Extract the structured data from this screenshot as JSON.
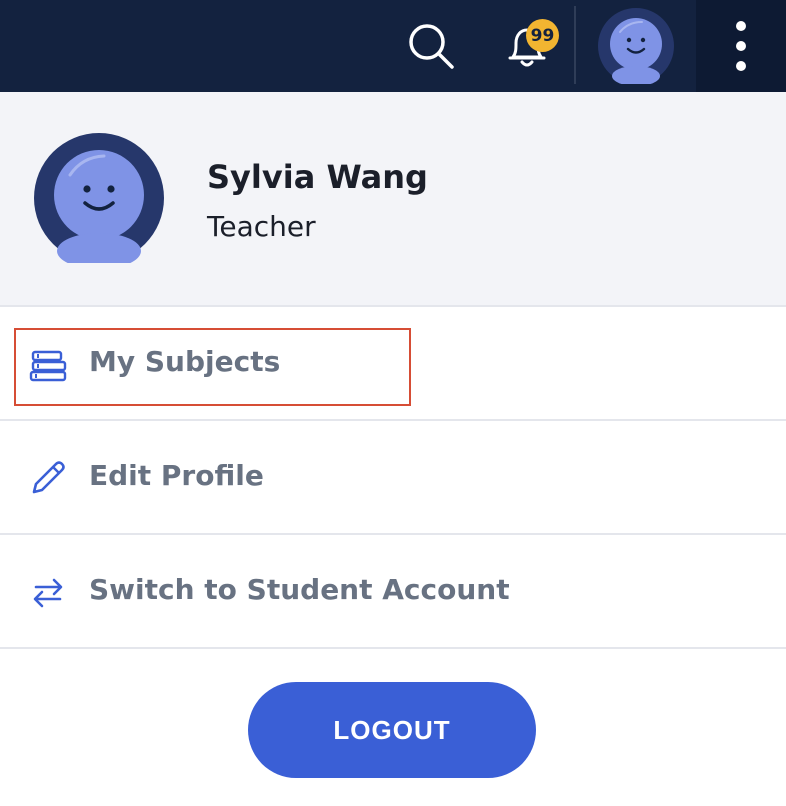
{
  "header": {
    "notification_count": "99",
    "icons": [
      "search-icon",
      "bell-icon",
      "avatar",
      "more-vertical-icon"
    ]
  },
  "profile": {
    "name": "Sylvia Wang",
    "role": "Teacher"
  },
  "menu": {
    "items": [
      {
        "label": "My Subjects",
        "icon": "books-icon",
        "highlighted": true
      },
      {
        "label": "Edit Profile",
        "icon": "pencil-icon"
      },
      {
        "label": "Switch to Student Account",
        "icon": "swap-arrows-icon"
      }
    ]
  },
  "logout_label": "LOGOUT",
  "colors": {
    "header_bg": "#13223f",
    "badge": "#f2b531",
    "accent": "#3a5fd6",
    "menu_text": "#687282",
    "highlight_border": "#d64d35",
    "avatar_outer": "#26376b",
    "avatar_face": "#7f93e6"
  }
}
